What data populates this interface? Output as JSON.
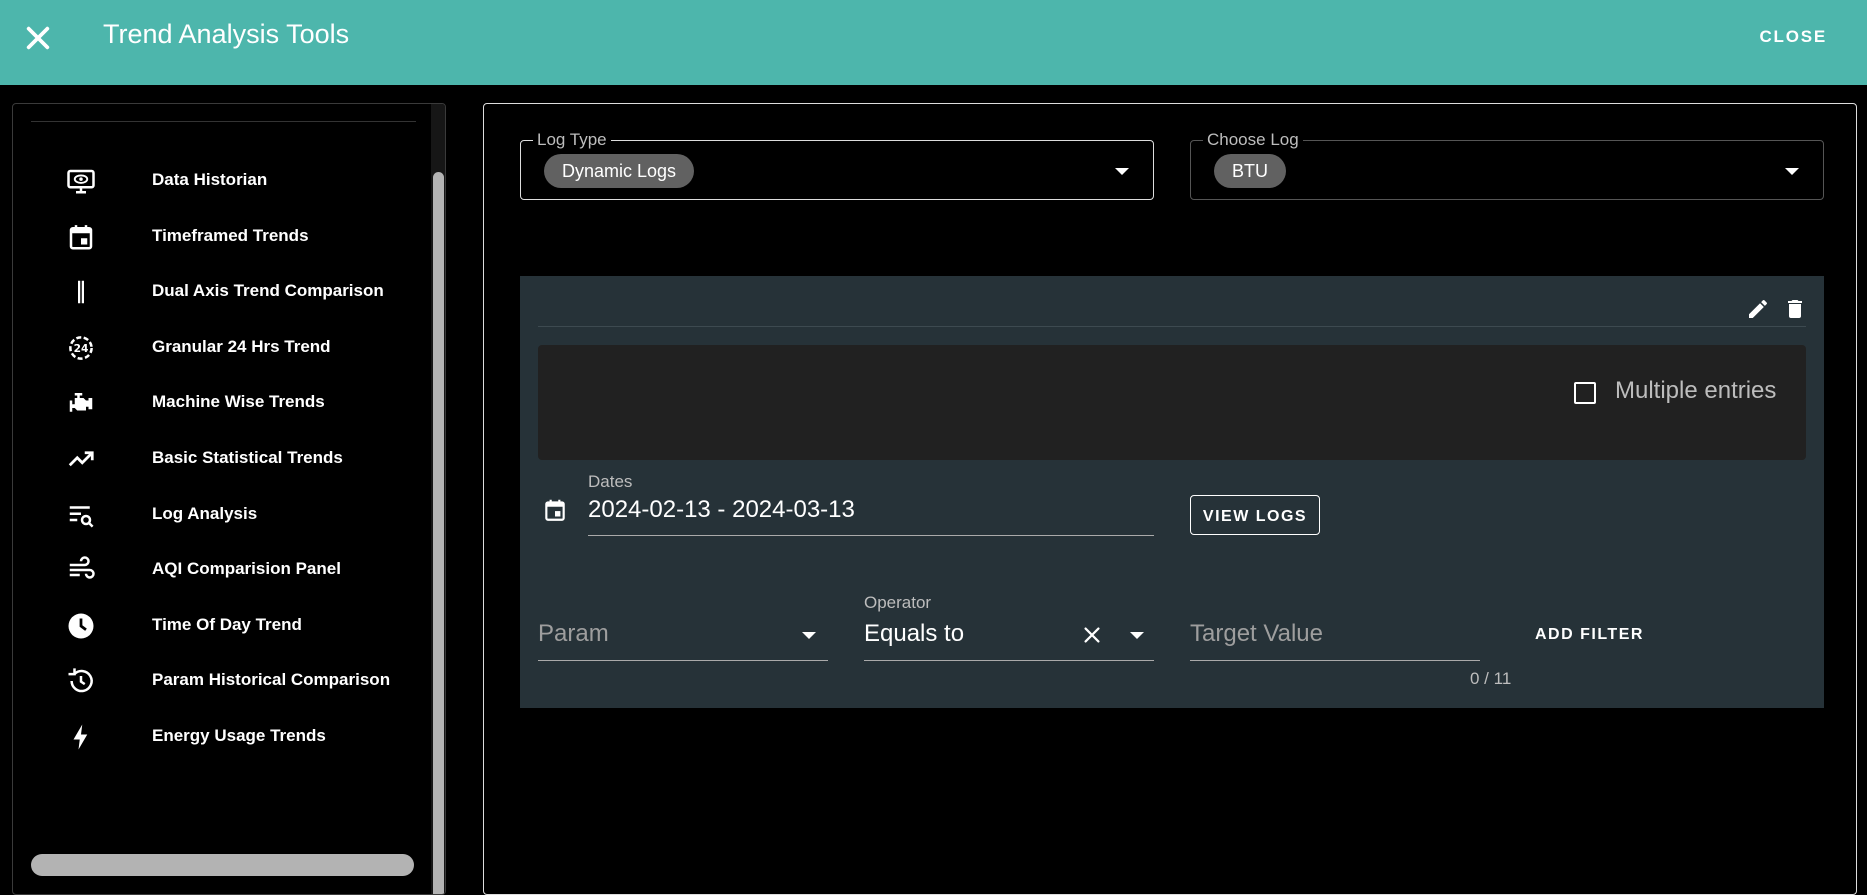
{
  "header": {
    "title": "Trend Analysis Tools",
    "close_label": "CLOSE",
    "bg_color": "#4db6ac"
  },
  "sidebar": {
    "items": [
      {
        "label": "Data Historian",
        "icon": "monitor-eye-icon"
      },
      {
        "label": "Timeframed Trends",
        "icon": "calendar-icon"
      },
      {
        "label": "Dual Axis Trend Comparison",
        "icon": "dual-bars-icon"
      },
      {
        "label": "Granular 24 Hrs Trend",
        "icon": "hours-24-icon"
      },
      {
        "label": "Machine Wise Trends",
        "icon": "engine-icon"
      },
      {
        "label": "Basic Statistical Trends",
        "icon": "trending-up-icon"
      },
      {
        "label": "Log Analysis",
        "icon": "list-search-icon"
      },
      {
        "label": "AQI Comparision Panel",
        "icon": "wind-icon"
      },
      {
        "label": "Time Of Day Trend",
        "icon": "clock-icon"
      },
      {
        "label": "Param Historical Comparison",
        "icon": "history-icon"
      },
      {
        "label": "Energy Usage Trends",
        "icon": "bolt-icon"
      }
    ]
  },
  "main": {
    "log_type": {
      "legend": "Log Type",
      "value": "Dynamic Logs"
    },
    "choose_log": {
      "legend": "Choose Log",
      "value": "BTU"
    },
    "multiple_entries_label": "Multiple entries",
    "dates": {
      "label": "Dates",
      "value": "2024-02-13 - 2024-03-13"
    },
    "view_logs_label": "VIEW LOGS",
    "filter": {
      "param_placeholder": "Param",
      "operator_label": "Operator",
      "operator_value": "Equals to",
      "target_placeholder": "Target Value",
      "counter": "0 / 11",
      "add_filter_label": "ADD FILTER"
    }
  }
}
